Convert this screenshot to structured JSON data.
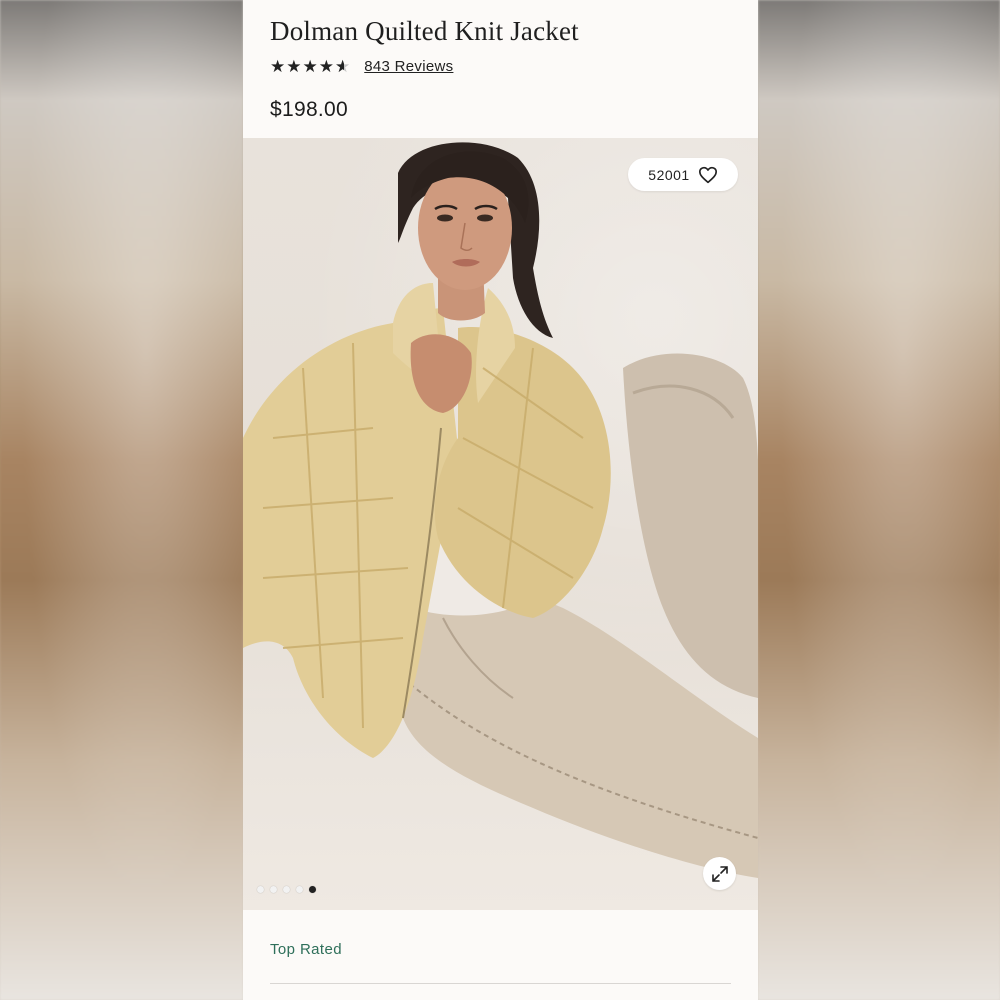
{
  "product": {
    "title": "Dolman Quilted Knit Jacket",
    "rating": 4.6,
    "rating_max": 5,
    "reviews_label": "843 Reviews",
    "price": "$198.00"
  },
  "gallery": {
    "likes_count": "52001",
    "heart_icon": "heart-outline-icon",
    "expand_icon": "expand-arrows-icon",
    "slide_count": 5,
    "active_slide": 5
  },
  "badges": {
    "top_rated": "Top Rated"
  },
  "colors": {
    "badge_text": "#2e6f5a",
    "page_bg": "#fbf9f7"
  }
}
